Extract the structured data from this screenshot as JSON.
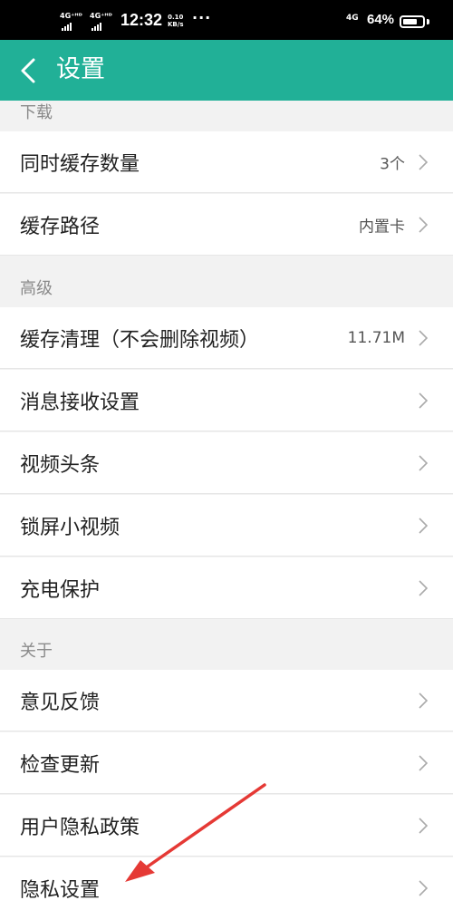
{
  "status_bar": {
    "sim1": "4G⁺ᴴᴰ",
    "sim2": "4G⁺ᴴᴰ",
    "time": "12:32",
    "speed_value": "0.10",
    "speed_unit": "KB/s",
    "more": "···",
    "network": "4G",
    "battery_text": "64%",
    "battery_level": 0.64
  },
  "header": {
    "back_icon": "chevron-left-icon",
    "title": "设置"
  },
  "sections": {
    "download": "下载",
    "advanced": "高级",
    "about": "关于"
  },
  "rows": {
    "cache_count": {
      "label": "同时缓存数量",
      "value": "3个"
    },
    "cache_path": {
      "label": "缓存路径",
      "value": "内置卡"
    },
    "cache_clear": {
      "label": "缓存清理（不会删除视频）",
      "value": "11.71M"
    },
    "message_settings": {
      "label": "消息接收设置"
    },
    "video_headlines": {
      "label": "视频头条"
    },
    "lockscreen_video": {
      "label": "锁屏小视频"
    },
    "charge_protect": {
      "label": "充电保护"
    },
    "feedback": {
      "label": "意见反馈"
    },
    "check_update": {
      "label": "检查更新"
    },
    "privacy_policy": {
      "label": "用户隐私政策"
    },
    "privacy_settings": {
      "label": "隐私设置"
    }
  },
  "colors": {
    "header": "#21b097",
    "annotation_arrow": "#e53935"
  }
}
